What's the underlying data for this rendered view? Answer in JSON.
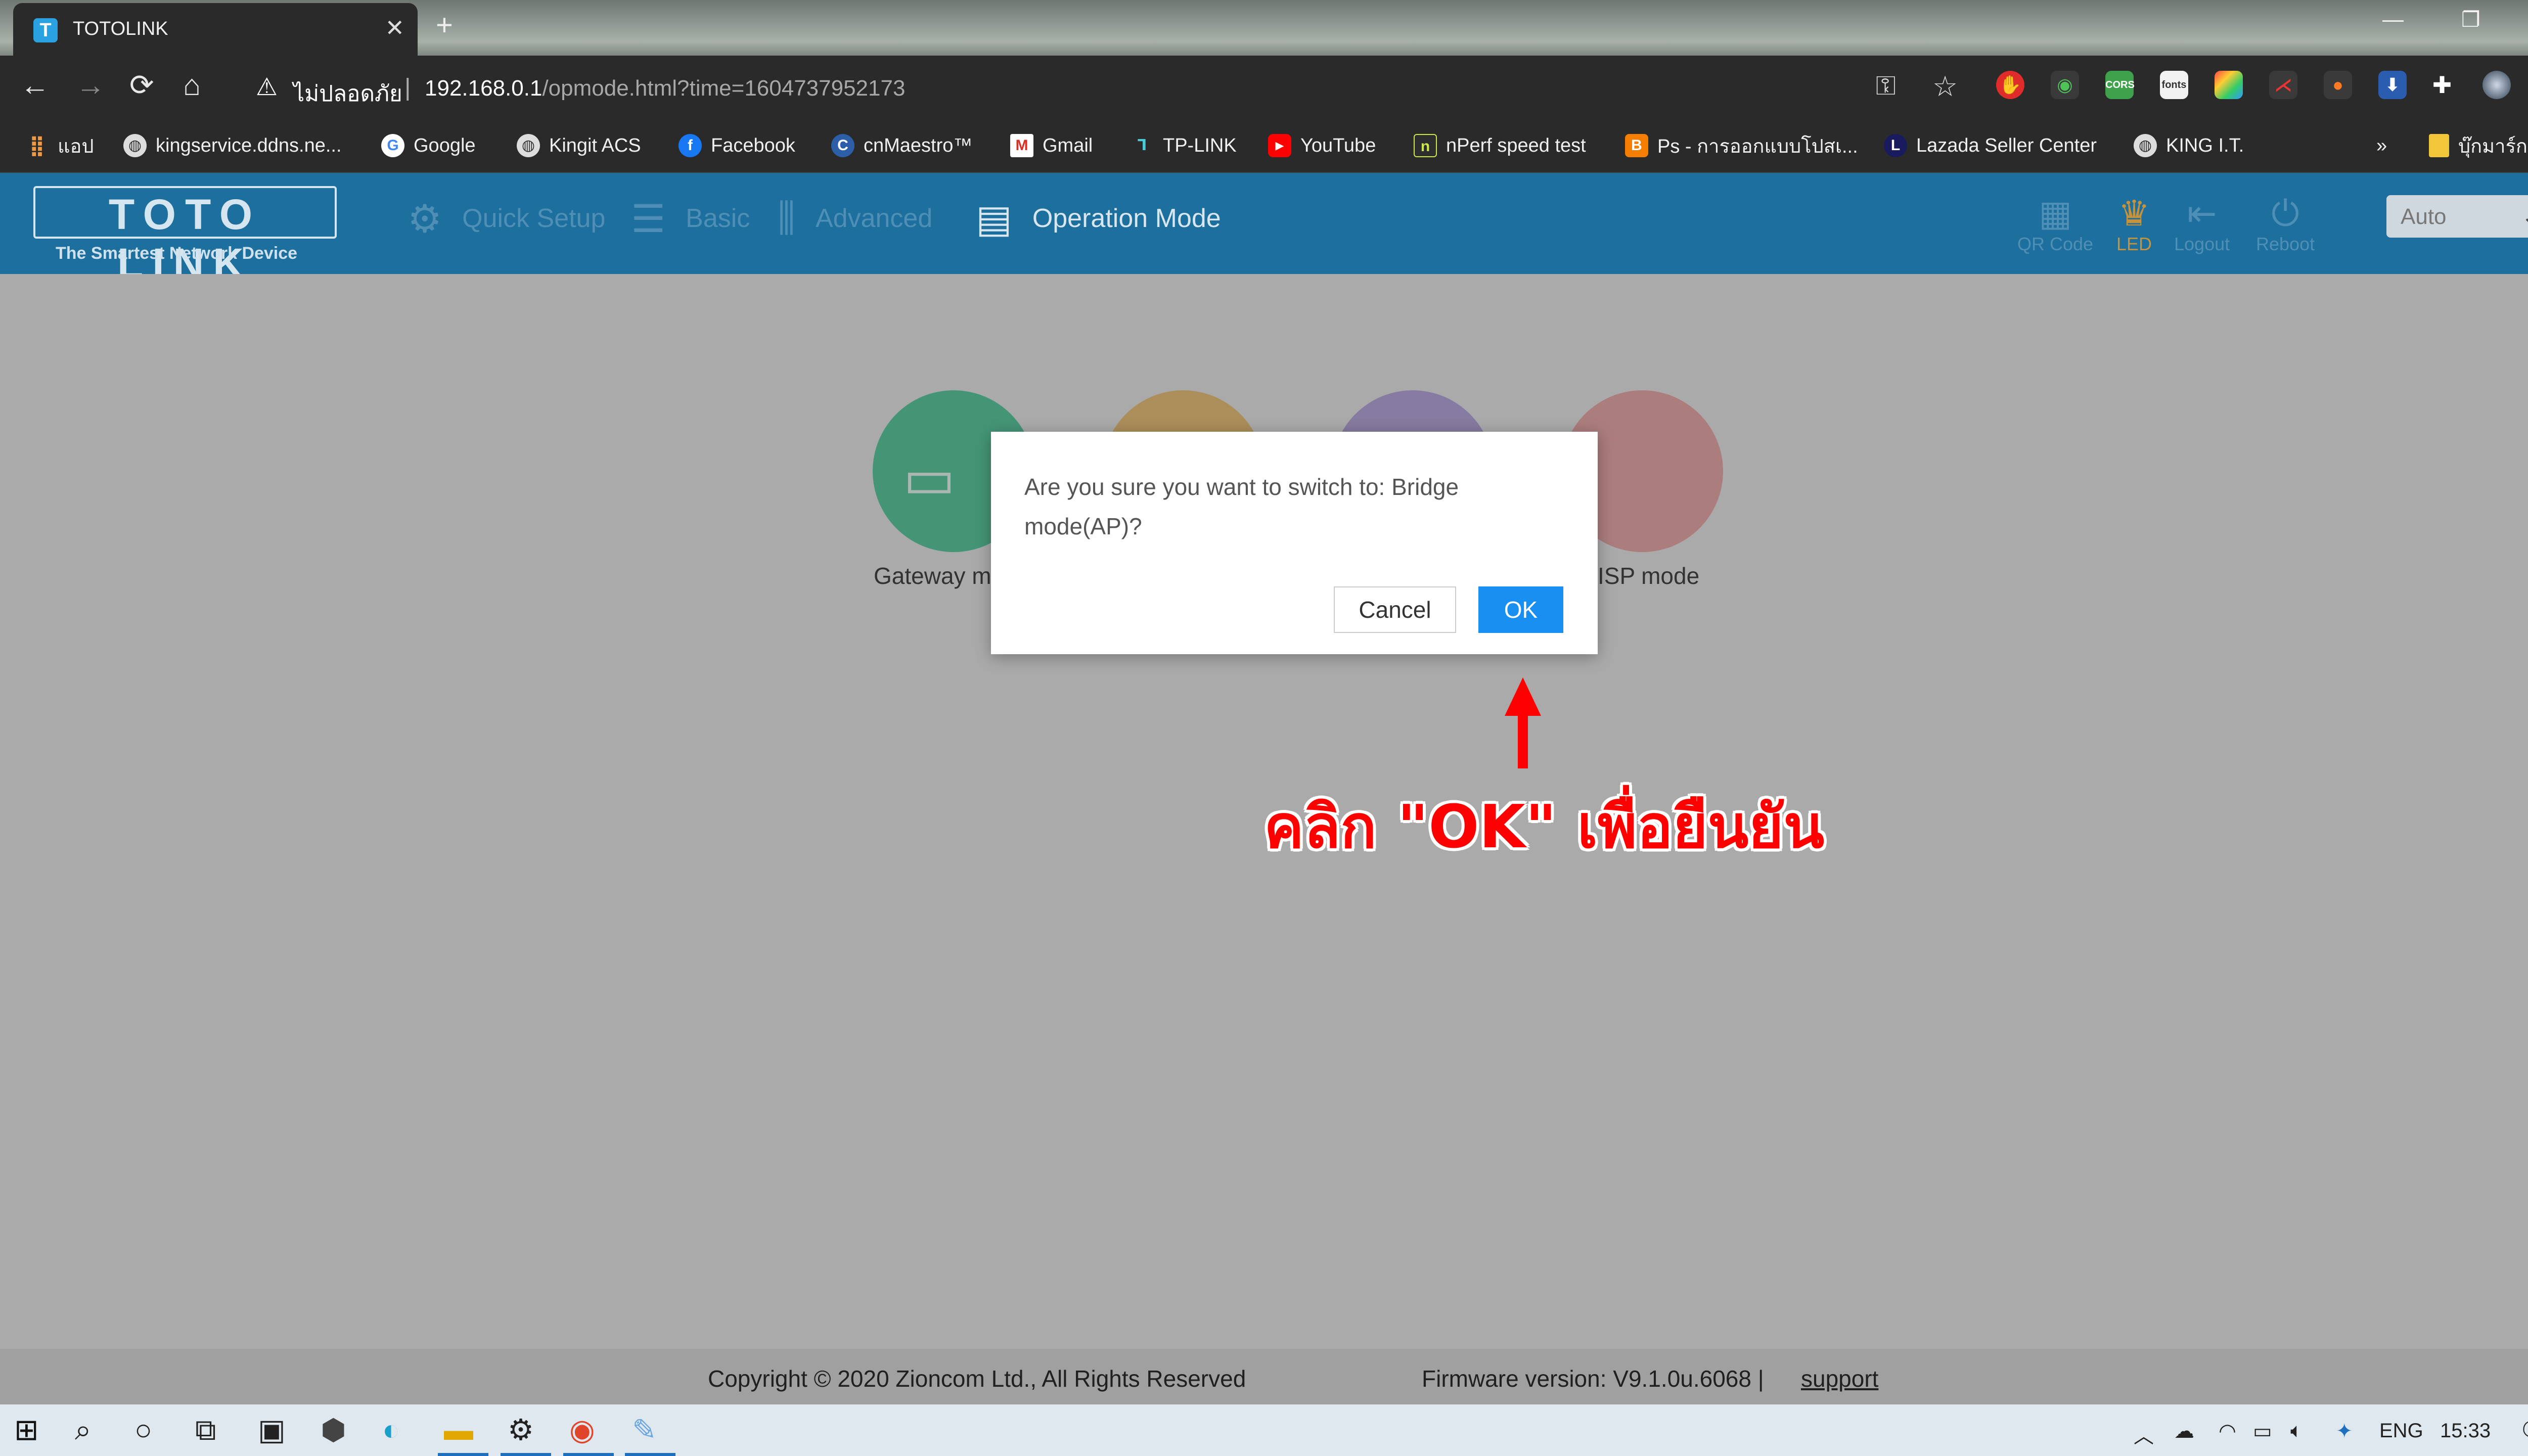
{
  "browser": {
    "tab_title": "TOTOLINK",
    "tab_favicon": "T",
    "tab_close": "✕",
    "new_tab": "+",
    "window_controls": [
      "—",
      "❐",
      "✕"
    ],
    "nav": {
      "back": "←",
      "forward": "→",
      "reload": "⟳",
      "home": "⌂"
    },
    "security_label": "ไม่ปลอดภัย",
    "address_host": "192.168.0.1",
    "address_path": "/opmode.html?time=1604737952173",
    "omnibox_icons": [
      "key-icon",
      "star-icon"
    ],
    "extension_icons": [
      "ext-red-icon",
      "ext-green-icon",
      "ext-cors-icon",
      "ext-fonts-icon",
      "ext-palette-icon",
      "ext-pdf-icon",
      "ext-orange-icon",
      "ext-download-icon",
      "puzzle-icon",
      "profile-avatar",
      "menu-dots-icon"
    ],
    "ext_cors_label": "CORS",
    "ext_fonts_label": "fonts"
  },
  "bookmarks": {
    "apps_label": "แอป",
    "items": [
      {
        "label": "kingservice.ddns.ne...",
        "icon": "globe-icon"
      },
      {
        "label": "Google",
        "icon": "google-icon"
      },
      {
        "label": "Kingit ACS",
        "icon": "globe-icon"
      },
      {
        "label": "Facebook",
        "icon": "facebook-icon"
      },
      {
        "label": "cnMaestro™",
        "icon": "cnmaestro-icon"
      },
      {
        "label": "Gmail",
        "icon": "gmail-icon"
      },
      {
        "label": "TP-LINK",
        "icon": "tplink-icon"
      },
      {
        "label": "YouTube",
        "icon": "youtube-icon"
      },
      {
        "label": "nPerf speed test",
        "icon": "nperf-icon"
      },
      {
        "label": "Ps - การออกแบบโปสเ...",
        "icon": "blogger-icon"
      },
      {
        "label": "Lazada Seller Center",
        "icon": "lazada-icon"
      },
      {
        "label": "KING I.T.",
        "icon": "globe-icon"
      }
    ],
    "overflow": "»",
    "other_bookmarks": "บุ๊กมาร์กอื่นๆ"
  },
  "app": {
    "logo_text": "TOTO LINK",
    "tagline": "The Smartest Network Device",
    "nav": [
      {
        "label": "Quick Setup",
        "icon": "gear-icon"
      },
      {
        "label": "Basic",
        "icon": "list-icon"
      },
      {
        "label": "Advanced",
        "icon": "sliders-icon"
      },
      {
        "label": "Operation Mode",
        "icon": "operation-mode-icon"
      }
    ],
    "tools": [
      {
        "label": "QR Code",
        "icon": "qr-code-icon"
      },
      {
        "label": "LED",
        "icon": "led-icon"
      },
      {
        "label": "Logout",
        "icon": "logout-icon"
      },
      {
        "label": "Reboot",
        "icon": "power-icon"
      }
    ],
    "language_select": "Auto"
  },
  "modes": [
    {
      "label": "Gateway m",
      "color": "#5cc9a0"
    },
    {
      "label": "",
      "color": "#e8c07a"
    },
    {
      "label": "",
      "color": "#b5a6d8"
    },
    {
      "label": "ISP mode",
      "color": "#e9a9a9"
    }
  ],
  "dialog": {
    "message": "Are you sure you want to switch to: Bridge mode(AP)?",
    "cancel_label": "Cancel",
    "ok_label": "OK"
  },
  "annotation": {
    "text": "คลิก \"OK\" เพื่อยืนยัน",
    "color": "#ff0000"
  },
  "footer": {
    "copyright": "Copyright © 2020 Zioncom Ltd., All Rights Reserved",
    "firmware": "Firmware version: V9.1.0u.6068   |",
    "support": "support"
  },
  "taskbar": {
    "apps": [
      "windows-start-icon",
      "search-icon",
      "cortana-icon",
      "task-view-icon",
      "store-icon",
      "app-cube-icon",
      "edge-icon",
      "file-explorer-icon",
      "settings-icon",
      "chrome-icon",
      "paint-icon"
    ],
    "language": "ENG",
    "time": "15:33"
  },
  "colors": {
    "header_bg": "#1d6f9e",
    "ok_button": "#1a8ff2",
    "chrome_dark": "#2a2a2a"
  }
}
